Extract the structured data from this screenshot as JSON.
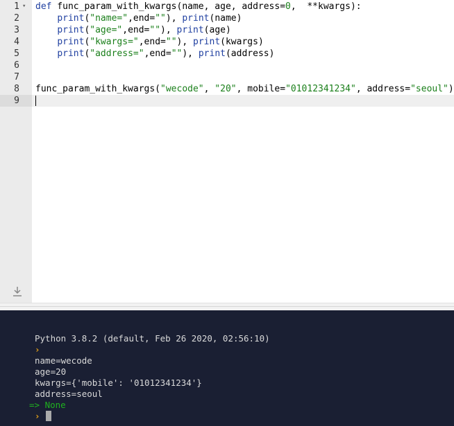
{
  "editor": {
    "line_numbers": [
      "1",
      "2",
      "3",
      "4",
      "5",
      "6",
      "7",
      "8",
      "9"
    ],
    "lines": [
      {
        "segments": [
          {
            "t": "def",
            "c": "kw"
          },
          {
            "t": " func_param_with_kwargs(name, age, address=",
            "c": ""
          },
          {
            "t": "0",
            "c": "num"
          },
          {
            "t": ",  **kwargs):",
            "c": ""
          }
        ]
      },
      {
        "segments": [
          {
            "t": "    ",
            "c": ""
          },
          {
            "t": "print",
            "c": "fn"
          },
          {
            "t": "(",
            "c": ""
          },
          {
            "t": "\"name=\"",
            "c": "str"
          },
          {
            "t": ",end=",
            "c": ""
          },
          {
            "t": "\"\"",
            "c": "str"
          },
          {
            "t": "), ",
            "c": ""
          },
          {
            "t": "print",
            "c": "fn"
          },
          {
            "t": "(name)",
            "c": ""
          }
        ]
      },
      {
        "segments": [
          {
            "t": "    ",
            "c": ""
          },
          {
            "t": "print",
            "c": "fn"
          },
          {
            "t": "(",
            "c": ""
          },
          {
            "t": "\"age=\"",
            "c": "str"
          },
          {
            "t": ",end=",
            "c": ""
          },
          {
            "t": "\"\"",
            "c": "str"
          },
          {
            "t": "), ",
            "c": ""
          },
          {
            "t": "print",
            "c": "fn"
          },
          {
            "t": "(age)",
            "c": ""
          }
        ]
      },
      {
        "segments": [
          {
            "t": "    ",
            "c": ""
          },
          {
            "t": "print",
            "c": "fn"
          },
          {
            "t": "(",
            "c": ""
          },
          {
            "t": "\"kwargs=\"",
            "c": "str"
          },
          {
            "t": ",end=",
            "c": ""
          },
          {
            "t": "\"\"",
            "c": "str"
          },
          {
            "t": "), ",
            "c": ""
          },
          {
            "t": "print",
            "c": "fn"
          },
          {
            "t": "(kwargs)",
            "c": ""
          }
        ]
      },
      {
        "segments": [
          {
            "t": "    ",
            "c": ""
          },
          {
            "t": "print",
            "c": "fn"
          },
          {
            "t": "(",
            "c": ""
          },
          {
            "t": "\"address=\"",
            "c": "str"
          },
          {
            "t": ",end=",
            "c": ""
          },
          {
            "t": "\"\"",
            "c": "str"
          },
          {
            "t": "), ",
            "c": ""
          },
          {
            "t": "print",
            "c": "fn"
          },
          {
            "t": "(address)",
            "c": ""
          }
        ]
      },
      {
        "segments": []
      },
      {
        "segments": []
      },
      {
        "segments": [
          {
            "t": "func_param_with_kwargs(",
            "c": ""
          },
          {
            "t": "\"wecode\"",
            "c": "str"
          },
          {
            "t": ", ",
            "c": ""
          },
          {
            "t": "\"20\"",
            "c": "str"
          },
          {
            "t": ", mobile=",
            "c": ""
          },
          {
            "t": "\"01012341234\"",
            "c": "str"
          },
          {
            "t": ", address=",
            "c": ""
          },
          {
            "t": "\"seoul\"",
            "c": "str"
          },
          {
            "t": ")",
            "c": ""
          }
        ]
      },
      {
        "segments": []
      }
    ],
    "fold_marker": "▾"
  },
  "console": {
    "banner": "Python 3.8.2 (default, Feb 26 2020, 02:56:10)",
    "prompt_symbol": "›",
    "output": [
      "name=wecode",
      "age=20",
      "kwargs={'mobile': '01012341234'}",
      "address=seoul"
    ],
    "result": "=> None"
  },
  "icons": {
    "download": "download-icon"
  }
}
